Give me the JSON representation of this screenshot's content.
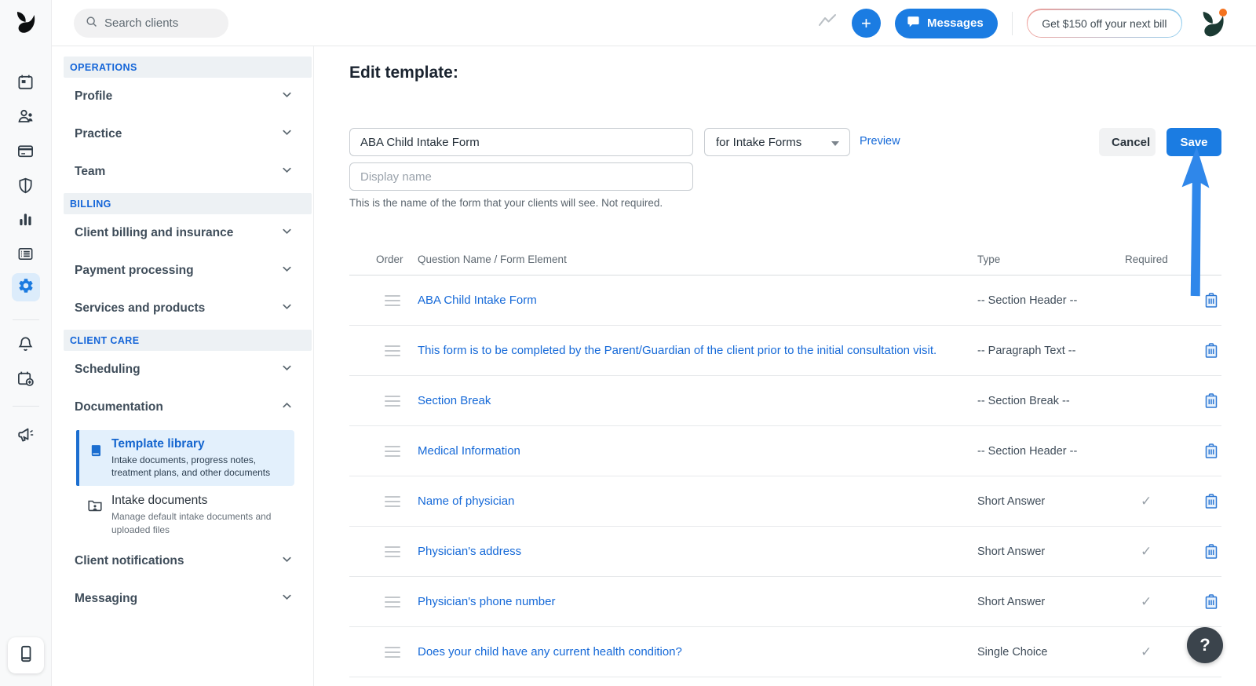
{
  "topbar": {
    "search_placeholder": "Search clients",
    "plus_label": "+",
    "messages_label": "Messages",
    "promo_label": "Get $150 off your next bill"
  },
  "sidebar": {
    "sections": [
      {
        "header": "OPERATIONS",
        "items": [
          {
            "label": "Profile"
          },
          {
            "label": "Practice"
          },
          {
            "label": "Team"
          }
        ]
      },
      {
        "header": "BILLING",
        "items": [
          {
            "label": "Client billing and insurance"
          },
          {
            "label": "Payment processing"
          },
          {
            "label": "Services and products"
          }
        ]
      },
      {
        "header": "CLIENT CARE",
        "items": [
          {
            "label": "Scheduling"
          },
          {
            "label": "Documentation"
          },
          {
            "label": "Client notifications"
          },
          {
            "label": "Messaging"
          }
        ]
      }
    ],
    "documentation_children": [
      {
        "title": "Template library",
        "description": "Intake documents, progress notes, treatment plans, and other documents",
        "active": true
      },
      {
        "title": "Intake documents",
        "description": "Manage default intake documents and uploaded files",
        "active": false
      }
    ]
  },
  "form": {
    "title": "Edit template:",
    "name_value": "ABA Child Intake Form",
    "display_name_placeholder": "Display name",
    "category_value": "for Intake Forms",
    "preview_label": "Preview",
    "cancel_label": "Cancel",
    "save_label": "Save",
    "helper_text": "This is the name of the form that your clients will see. Not required."
  },
  "table": {
    "headers": {
      "order": "Order",
      "question": "Question Name / Form Element",
      "type": "Type",
      "required": "Required"
    },
    "rows": [
      {
        "name": "ABA Child Intake Form",
        "type": "-- Section Header --",
        "required_mark": ""
      },
      {
        "name": "This form is to be completed by the Parent/Guardian of the client prior to the initial consultation visit.",
        "type": "-- Paragraph Text --",
        "required_mark": ""
      },
      {
        "name": "Section Break",
        "type": "-- Section Break --",
        "required_mark": ""
      },
      {
        "name": "Medical Information",
        "type": "-- Section Header --",
        "required_mark": ""
      },
      {
        "name": "Name of physician",
        "type": "Short Answer",
        "required_mark": "✓"
      },
      {
        "name": "Physician's address",
        "type": "Short Answer",
        "required_mark": "✓"
      },
      {
        "name": "Physician's phone number",
        "type": "Short Answer",
        "required_mark": "✓"
      },
      {
        "name": "Does your child have any current health condition?",
        "type": "Single Choice",
        "required_mark": "✓"
      }
    ]
  },
  "help_button_label": "?",
  "icons": {
    "rail": [
      "calendar-icon",
      "people-icon",
      "credit-card-icon",
      "shield-icon",
      "bar-chart-icon",
      "list-icon",
      "gear-icon",
      "bell-icon",
      "calendar-plus-icon",
      "megaphone-icon",
      "smartphone-icon"
    ],
    "topbar": [
      "logo-icon",
      "search-icon",
      "trending-icon",
      "plus-icon",
      "chat-bubble-icon",
      "avatar-logo-icon"
    ],
    "table": [
      "drag-handle-icon",
      "trash-icon",
      "check-icon"
    ],
    "annotation": "blue-up-arrow"
  },
  "colors": {
    "accent_blue": "#1b7ce2",
    "link_blue": "#1569d8",
    "section_header_blue": "#1465d8",
    "active_item_bg": "#e3f0fc",
    "rail_bg": "#f8f9fa",
    "help_fab_bg": "#3b444c",
    "notification_dot": "#f4731f",
    "annotation_arrow": "#2f87ea"
  }
}
